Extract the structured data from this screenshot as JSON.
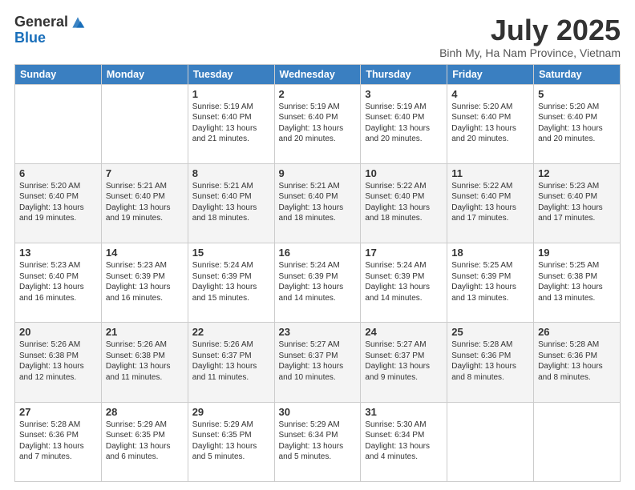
{
  "header": {
    "logo_line1": "General",
    "logo_line2": "Blue",
    "month_year": "July 2025",
    "location": "Binh My, Ha Nam Province, Vietnam"
  },
  "weekdays": [
    "Sunday",
    "Monday",
    "Tuesday",
    "Wednesday",
    "Thursday",
    "Friday",
    "Saturday"
  ],
  "weeks": [
    [
      {
        "day": "",
        "info": ""
      },
      {
        "day": "",
        "info": ""
      },
      {
        "day": "1",
        "info": "Sunrise: 5:19 AM\nSunset: 6:40 PM\nDaylight: 13 hours and 21 minutes."
      },
      {
        "day": "2",
        "info": "Sunrise: 5:19 AM\nSunset: 6:40 PM\nDaylight: 13 hours and 20 minutes."
      },
      {
        "day": "3",
        "info": "Sunrise: 5:19 AM\nSunset: 6:40 PM\nDaylight: 13 hours and 20 minutes."
      },
      {
        "day": "4",
        "info": "Sunrise: 5:20 AM\nSunset: 6:40 PM\nDaylight: 13 hours and 20 minutes."
      },
      {
        "day": "5",
        "info": "Sunrise: 5:20 AM\nSunset: 6:40 PM\nDaylight: 13 hours and 20 minutes."
      }
    ],
    [
      {
        "day": "6",
        "info": "Sunrise: 5:20 AM\nSunset: 6:40 PM\nDaylight: 13 hours and 19 minutes."
      },
      {
        "day": "7",
        "info": "Sunrise: 5:21 AM\nSunset: 6:40 PM\nDaylight: 13 hours and 19 minutes."
      },
      {
        "day": "8",
        "info": "Sunrise: 5:21 AM\nSunset: 6:40 PM\nDaylight: 13 hours and 18 minutes."
      },
      {
        "day": "9",
        "info": "Sunrise: 5:21 AM\nSunset: 6:40 PM\nDaylight: 13 hours and 18 minutes."
      },
      {
        "day": "10",
        "info": "Sunrise: 5:22 AM\nSunset: 6:40 PM\nDaylight: 13 hours and 18 minutes."
      },
      {
        "day": "11",
        "info": "Sunrise: 5:22 AM\nSunset: 6:40 PM\nDaylight: 13 hours and 17 minutes."
      },
      {
        "day": "12",
        "info": "Sunrise: 5:23 AM\nSunset: 6:40 PM\nDaylight: 13 hours and 17 minutes."
      }
    ],
    [
      {
        "day": "13",
        "info": "Sunrise: 5:23 AM\nSunset: 6:40 PM\nDaylight: 13 hours and 16 minutes."
      },
      {
        "day": "14",
        "info": "Sunrise: 5:23 AM\nSunset: 6:39 PM\nDaylight: 13 hours and 16 minutes."
      },
      {
        "day": "15",
        "info": "Sunrise: 5:24 AM\nSunset: 6:39 PM\nDaylight: 13 hours and 15 minutes."
      },
      {
        "day": "16",
        "info": "Sunrise: 5:24 AM\nSunset: 6:39 PM\nDaylight: 13 hours and 14 minutes."
      },
      {
        "day": "17",
        "info": "Sunrise: 5:24 AM\nSunset: 6:39 PM\nDaylight: 13 hours and 14 minutes."
      },
      {
        "day": "18",
        "info": "Sunrise: 5:25 AM\nSunset: 6:39 PM\nDaylight: 13 hours and 13 minutes."
      },
      {
        "day": "19",
        "info": "Sunrise: 5:25 AM\nSunset: 6:38 PM\nDaylight: 13 hours and 13 minutes."
      }
    ],
    [
      {
        "day": "20",
        "info": "Sunrise: 5:26 AM\nSunset: 6:38 PM\nDaylight: 13 hours and 12 minutes."
      },
      {
        "day": "21",
        "info": "Sunrise: 5:26 AM\nSunset: 6:38 PM\nDaylight: 13 hours and 11 minutes."
      },
      {
        "day": "22",
        "info": "Sunrise: 5:26 AM\nSunset: 6:37 PM\nDaylight: 13 hours and 11 minutes."
      },
      {
        "day": "23",
        "info": "Sunrise: 5:27 AM\nSunset: 6:37 PM\nDaylight: 13 hours and 10 minutes."
      },
      {
        "day": "24",
        "info": "Sunrise: 5:27 AM\nSunset: 6:37 PM\nDaylight: 13 hours and 9 minutes."
      },
      {
        "day": "25",
        "info": "Sunrise: 5:28 AM\nSunset: 6:36 PM\nDaylight: 13 hours and 8 minutes."
      },
      {
        "day": "26",
        "info": "Sunrise: 5:28 AM\nSunset: 6:36 PM\nDaylight: 13 hours and 8 minutes."
      }
    ],
    [
      {
        "day": "27",
        "info": "Sunrise: 5:28 AM\nSunset: 6:36 PM\nDaylight: 13 hours and 7 minutes."
      },
      {
        "day": "28",
        "info": "Sunrise: 5:29 AM\nSunset: 6:35 PM\nDaylight: 13 hours and 6 minutes."
      },
      {
        "day": "29",
        "info": "Sunrise: 5:29 AM\nSunset: 6:35 PM\nDaylight: 13 hours and 5 minutes."
      },
      {
        "day": "30",
        "info": "Sunrise: 5:29 AM\nSunset: 6:34 PM\nDaylight: 13 hours and 5 minutes."
      },
      {
        "day": "31",
        "info": "Sunrise: 5:30 AM\nSunset: 6:34 PM\nDaylight: 13 hours and 4 minutes."
      },
      {
        "day": "",
        "info": ""
      },
      {
        "day": "",
        "info": ""
      }
    ]
  ]
}
